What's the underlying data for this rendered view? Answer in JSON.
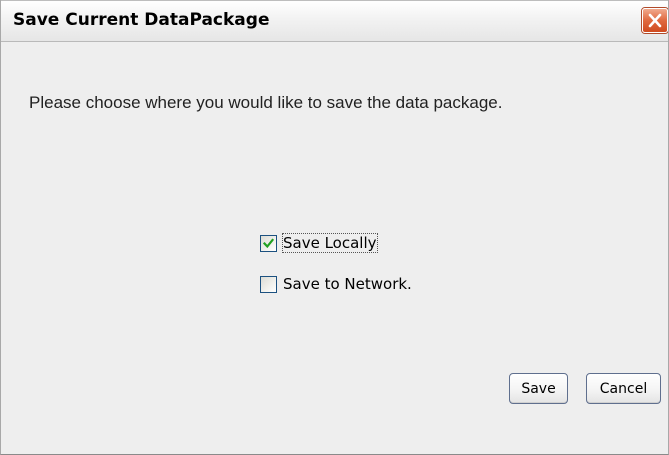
{
  "window": {
    "title": "Save Current DataPackage"
  },
  "dialog": {
    "message": "Please choose where you would like to save the data package."
  },
  "options": [
    {
      "label": "Save Locally",
      "checked": true
    },
    {
      "label": "Save to Network.",
      "checked": false
    }
  ],
  "buttons": {
    "save_label": "Save",
    "cancel_label": "Cancel"
  },
  "icons": {
    "close": "close-icon",
    "check": "checkmark-icon"
  },
  "colors": {
    "close_button": "#e0693f",
    "check_mark": "#21a121",
    "checkbox_border": "#1c5180",
    "background": "#eeeeee"
  }
}
